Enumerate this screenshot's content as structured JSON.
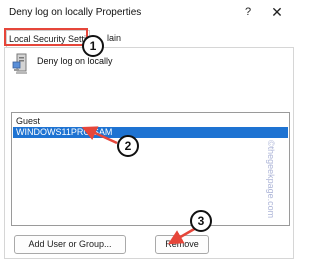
{
  "window": {
    "title": "Deny log on locally Properties",
    "help_label": "?",
    "close_label": "✕"
  },
  "tabs": [
    {
      "label": "Local Security Setting",
      "active": true
    },
    {
      "label": "Explain",
      "shown": "lain",
      "active": false
    }
  ],
  "policy": {
    "name": "Deny log on locally",
    "shown_name": "Deny log on locally",
    "icon": "server-computer-icon"
  },
  "list": {
    "items": [
      "Guest",
      "WINDOWS11PRO\\SAM"
    ],
    "selected_index": 1
  },
  "buttons": {
    "add_label": "Add User or Group...",
    "remove_label": "Remove"
  },
  "annotations": {
    "steps": [
      "1",
      "2",
      "3"
    ],
    "color": "#e6463a"
  },
  "watermark": "©thegeekpage.com"
}
